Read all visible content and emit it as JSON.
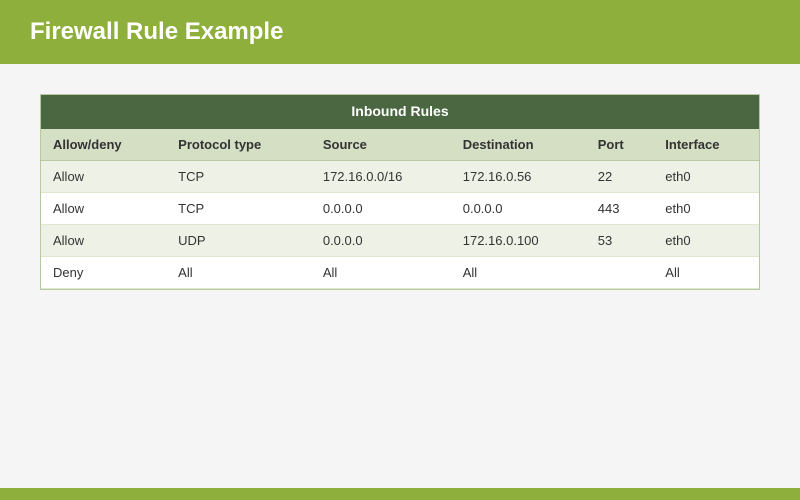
{
  "header": {
    "title": "Firewall Rule Example"
  },
  "table": {
    "section_title": "Inbound Rules",
    "columns": [
      "Allow/deny",
      "Protocol type",
      "Source",
      "Destination",
      "Port",
      "Interface"
    ],
    "rows": [
      [
        "Allow",
        "TCP",
        "172.16.0.0/16",
        "172.16.0.56",
        "22",
        "eth0"
      ],
      [
        "Allow",
        "TCP",
        "0.0.0.0",
        "0.0.0.0",
        "443",
        "eth0"
      ],
      [
        "Allow",
        "UDP",
        "0.0.0.0",
        "172.16.0.100",
        "53",
        "eth0"
      ],
      [
        "Deny",
        "All",
        "All",
        "All",
        "",
        "All"
      ]
    ]
  }
}
